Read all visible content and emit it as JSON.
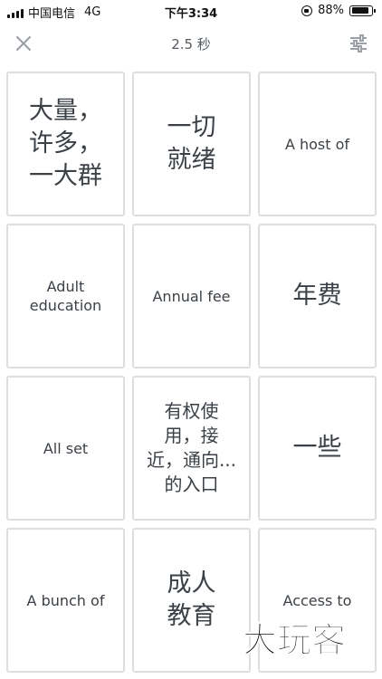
{
  "status_bar": {
    "carrier": "中国电信",
    "network": "4G",
    "time": "下午3:34",
    "battery": "88%",
    "battery_level": 0.88
  },
  "header": {
    "timer": "2.5 秒",
    "close_icon": "close-icon",
    "settings_icon": "sliders-icon"
  },
  "cards": [
    {
      "text": "大量，\n许多，\n一大群",
      "style": "cjk-lg"
    },
    {
      "text": "一切\n就绪",
      "style": "cjk-lg"
    },
    {
      "text": "A host of",
      "style": "en"
    },
    {
      "text": "Adult\neducation",
      "style": "en"
    },
    {
      "text": "Annual fee",
      "style": "en"
    },
    {
      "text": "年费",
      "style": "cjk-lg"
    },
    {
      "text": "All set",
      "style": "en"
    },
    {
      "text": "有权使\n用，接\n近，通向...\n的入口",
      "style": "cjk-md"
    },
    {
      "text": "一些",
      "style": "cjk-lg"
    },
    {
      "text": "A bunch of",
      "style": "en"
    },
    {
      "text": "成人\n教育",
      "style": "cjk-lg"
    },
    {
      "text": "Access to",
      "style": "en"
    }
  ],
  "watermark": "大玩客",
  "colors": {
    "card_border": "#dcdfe2",
    "text": "#3b4147",
    "icon": "#9aa0a6"
  }
}
